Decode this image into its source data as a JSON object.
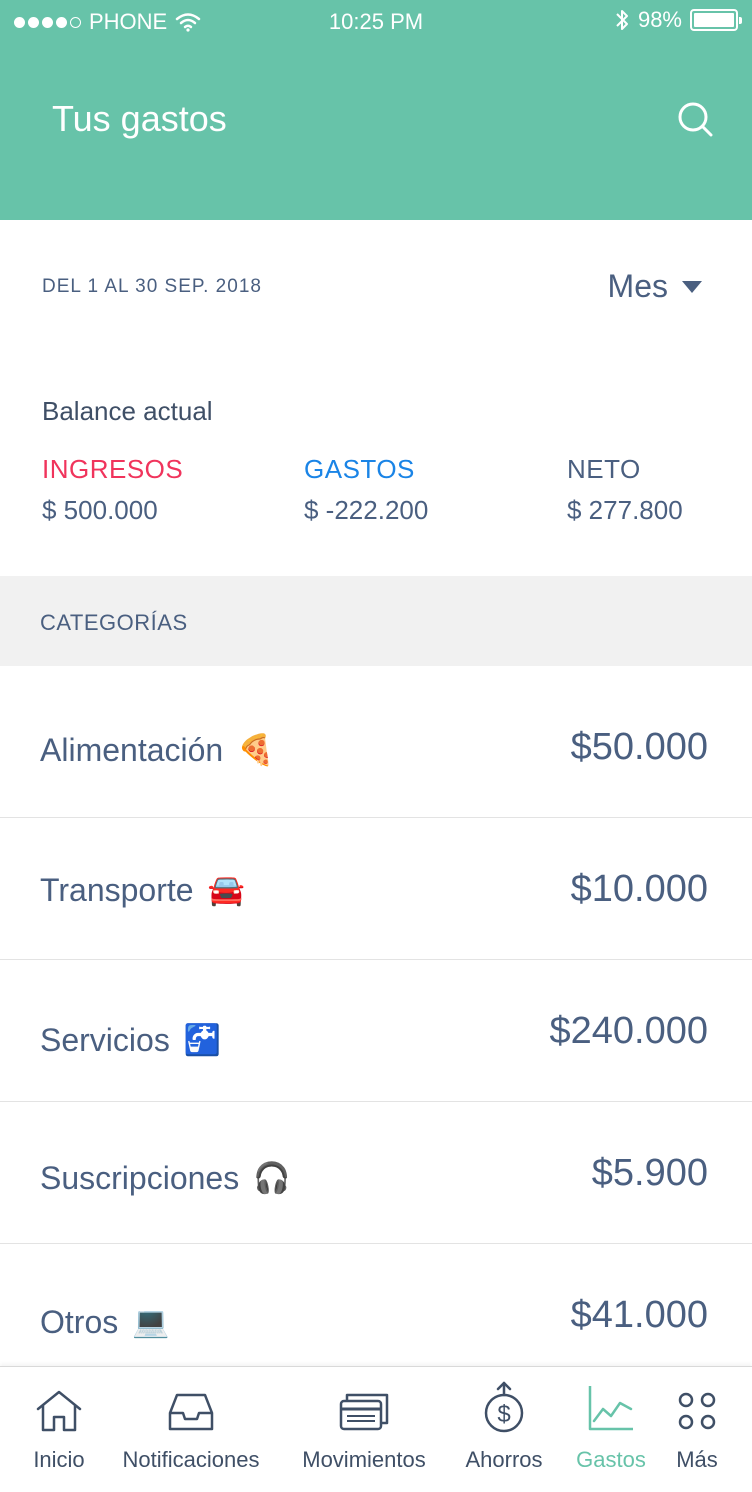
{
  "status_bar": {
    "carrier": "PHONE",
    "time": "10:25 PM",
    "battery": "98%"
  },
  "header": {
    "title": "Tus gastos",
    "search_icon": "search-icon"
  },
  "period": {
    "range": "DEL 1 AL 30 SEP. 2018",
    "mode": "Mes"
  },
  "balance": {
    "title": "Balance actual",
    "ingresos_label": "INGRESOS",
    "ingresos_value": "$ 500.000",
    "gastos_label": "GASTOS",
    "gastos_value": "$ -222.200",
    "neto_label": "NETO",
    "neto_value": "$ 277.800"
  },
  "categories": {
    "header": "CATEGORÍAS",
    "items": [
      {
        "name": "Alimentación",
        "emoji": "🍕",
        "amount": "$50.000"
      },
      {
        "name": "Transporte",
        "emoji": "🚘",
        "amount": "$10.000"
      },
      {
        "name": "Servicios",
        "emoji": "🚰",
        "amount": "$240.000"
      },
      {
        "name": "Suscripciones",
        "emoji": "🎧",
        "amount": "$5.900"
      },
      {
        "name": "Otros",
        "emoji": "💻",
        "amount": "$41.000"
      }
    ]
  },
  "tabs": [
    {
      "label": "Inicio",
      "icon": "home-icon"
    },
    {
      "label": "Notificaciones",
      "icon": "inbox-icon"
    },
    {
      "label": "Movimientos",
      "icon": "cards-icon"
    },
    {
      "label": "Ahorros",
      "icon": "savings-icon"
    },
    {
      "label": "Gastos",
      "icon": "chart-icon",
      "active": true
    },
    {
      "label": "Más",
      "icon": "more-icon"
    }
  ],
  "colors": {
    "header": "#67c3a9",
    "ingresos": "#f0345c",
    "gastos": "#1a84e6",
    "text": "#4a5f80",
    "active_tab": "#67c3a9"
  }
}
